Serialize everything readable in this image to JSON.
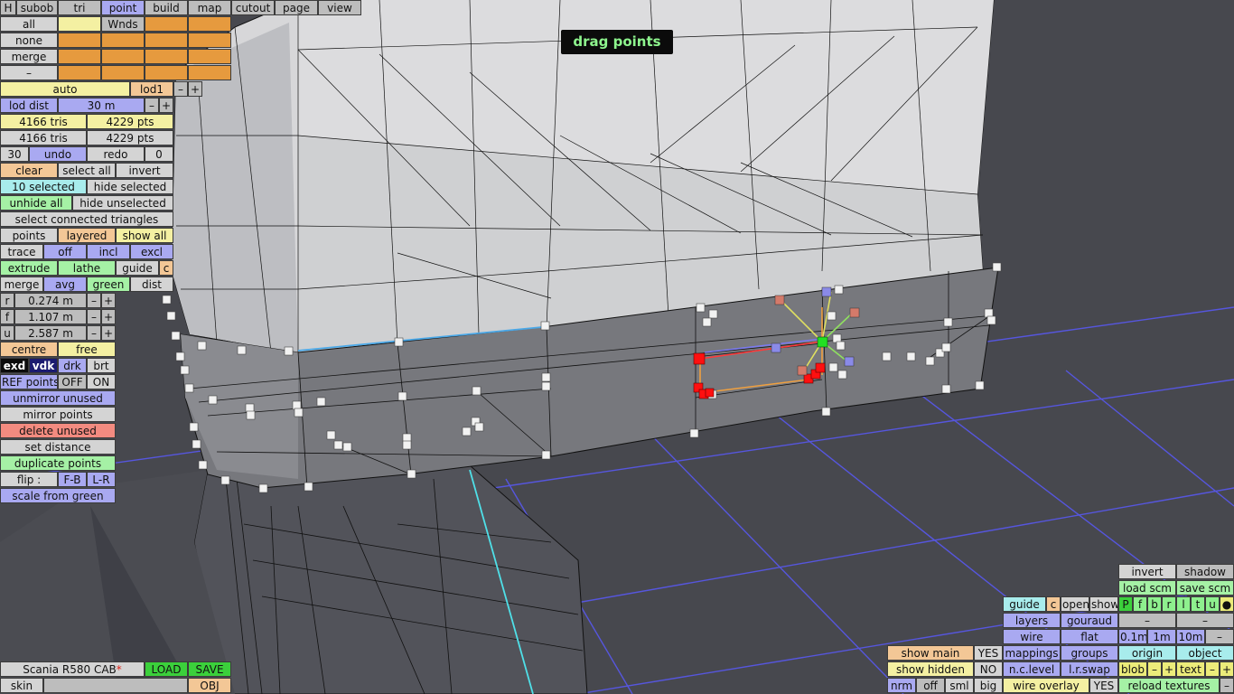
{
  "overlay": {
    "hint": "drag points"
  },
  "menu": {
    "tabs": [
      "H",
      "subob",
      "tri",
      "point",
      "build",
      "map",
      "cutout",
      "page",
      "view"
    ],
    "active_tab": "point"
  },
  "selection": {
    "all": "all",
    "none": "none",
    "merge": "merge",
    "dash": "–",
    "wnds": "Wnds"
  },
  "lod": {
    "auto": "auto",
    "lod": "lod1",
    "minus": "–",
    "plus": "+",
    "dist_label": "lod dist",
    "dist_value": "30 m"
  },
  "stats": {
    "tris_a": "4166 tris",
    "pts_a": "4229 pts",
    "tris_b": "4166 tris",
    "pts_b": "4229 pts"
  },
  "history": {
    "count": "30",
    "undo": "undo",
    "redo": "redo",
    "redo_count": "0"
  },
  "actions": {
    "clear": "clear",
    "select_all": "select all",
    "invert": "invert",
    "selected": "10 selected",
    "hide_selected": "hide selected",
    "unhide_all": "unhide all",
    "hide_unselected": "hide unselected",
    "select_connected": "select connected triangles",
    "points": "points",
    "layered": "layered",
    "show_all": "show all",
    "trace": "trace",
    "off": "off",
    "incl": "incl",
    "excl": "excl",
    "extrude": "extrude",
    "lathe": "lathe",
    "guide": "guide",
    "c": "c",
    "merge": "merge",
    "avg": "avg",
    "green": "green",
    "dist": "dist"
  },
  "coords": [
    {
      "axis": "r",
      "value": "0.274 m"
    },
    {
      "axis": "f",
      "value": "1.107 m"
    },
    {
      "axis": "u",
      "value": "2.587 m"
    }
  ],
  "mirror": {
    "centre": "centre",
    "free": "free",
    "exd": "exd",
    "vdk": "vdk",
    "drk": "drk",
    "brt": "brt",
    "ref_points": "REF points",
    "ref_off": "OFF",
    "ref_on": "ON",
    "unmirror_unused": "unmirror unused",
    "mirror_points": "mirror points",
    "delete_unused": "delete unused",
    "set_distance": "set distance",
    "duplicate_points": "duplicate points",
    "flip": "flip :",
    "fb": "F-B",
    "lr": "L-R",
    "scale_from_green": "scale from green"
  },
  "file": {
    "name": "Scania R580 CAB",
    "modified_mark": "*",
    "load": "LOAD",
    "save": "SAVE",
    "skin": "skin",
    "obj": "OBJ"
  },
  "display": {
    "invert": "invert",
    "shadow": "shadow",
    "load_scm": "load scm",
    "save_scm": "save scm",
    "guide": "guide",
    "c": "c",
    "open": "open",
    "show": "show",
    "axis_letters": [
      "P",
      "f",
      "b",
      "r",
      "l",
      "t",
      "u",
      "●"
    ],
    "layers": "layers",
    "gouraud": "gouraud",
    "dash": "–",
    "wire": "wire",
    "flat": "flat",
    "d01": "0.1m",
    "d1": "1m",
    "d10": "10m",
    "show_main": "show main",
    "yes": "YES",
    "mappings": "mappings",
    "groups": "groups",
    "origin": "origin",
    "object": "object",
    "show_hidden": "show hidden",
    "no": "NO",
    "nc_level": "n.c.level",
    "lr_swap": "l.r.swap",
    "blob": "blob",
    "minus": "–",
    "plus": "+",
    "text": "text",
    "nrm": "nrm",
    "off": "off",
    "sml": "sml",
    "big": "big",
    "wire_overlay": "wire overlay",
    "wire_overlay_state": "YES",
    "reload_textures": "reload textures"
  },
  "colors": {
    "selected_point": "#ff1010",
    "green_point": "#22e022",
    "grid": "#5a5ae0",
    "accent": "#4fe0e8"
  }
}
